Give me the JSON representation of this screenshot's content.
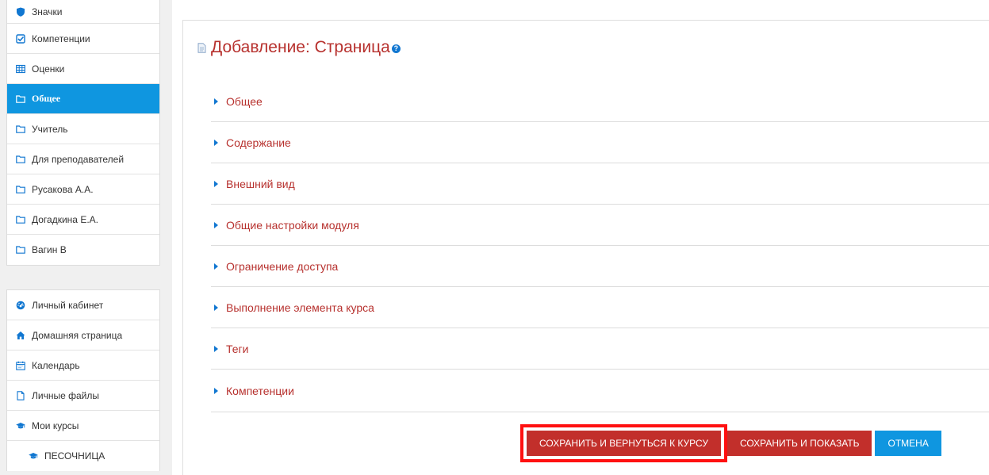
{
  "sidebar": {
    "course_items": [
      {
        "label": "Значки",
        "icon": "shield-icon"
      },
      {
        "label": "Компетенции",
        "icon": "checkbox-icon"
      },
      {
        "label": "Оценки",
        "icon": "table-icon"
      },
      {
        "label": "Общее",
        "icon": "folder-icon",
        "active": true
      },
      {
        "label": "Учитель",
        "icon": "folder-icon"
      },
      {
        "label": "Для преподавателей",
        "icon": "folder-icon"
      },
      {
        "label": "Русакова А.А.",
        "icon": "folder-icon"
      },
      {
        "label": "Догадкина Е.А.",
        "icon": "folder-icon"
      },
      {
        "label": "Вагин В",
        "icon": "folder-icon"
      }
    ],
    "site_items": [
      {
        "label": "Личный кабинет",
        "icon": "dashboard-icon"
      },
      {
        "label": "Домашняя страница",
        "icon": "home-icon"
      },
      {
        "label": "Календарь",
        "icon": "calendar-icon"
      },
      {
        "label": "Личные файлы",
        "icon": "file-icon"
      },
      {
        "label": "Мои курсы",
        "icon": "graduation-cap-icon"
      },
      {
        "label": "ПЕСОЧНИЦА",
        "icon": "graduation-cap-icon",
        "indent": true
      }
    ]
  },
  "main": {
    "title": "Добавление: Страница",
    "help_glyph": "?",
    "sections": [
      "Общее",
      "Содержание",
      "Внешний вид",
      "Общие настройки модуля",
      "Ограничение доступа",
      "Выполнение элемента курса",
      "Теги",
      "Компетенции"
    ]
  },
  "actions": {
    "save_return": "СОХРАНИТЬ И ВЕРНУТЬСЯ К КУРСУ",
    "save_display": "СОХРАНИТЬ И ПОКАЗАТЬ",
    "cancel": "ОТМЕНА"
  },
  "colors": {
    "accent": "#0f96e0",
    "title_red": "#b7312e",
    "button_red": "#c22f2b",
    "highlight": "#ff1010"
  }
}
